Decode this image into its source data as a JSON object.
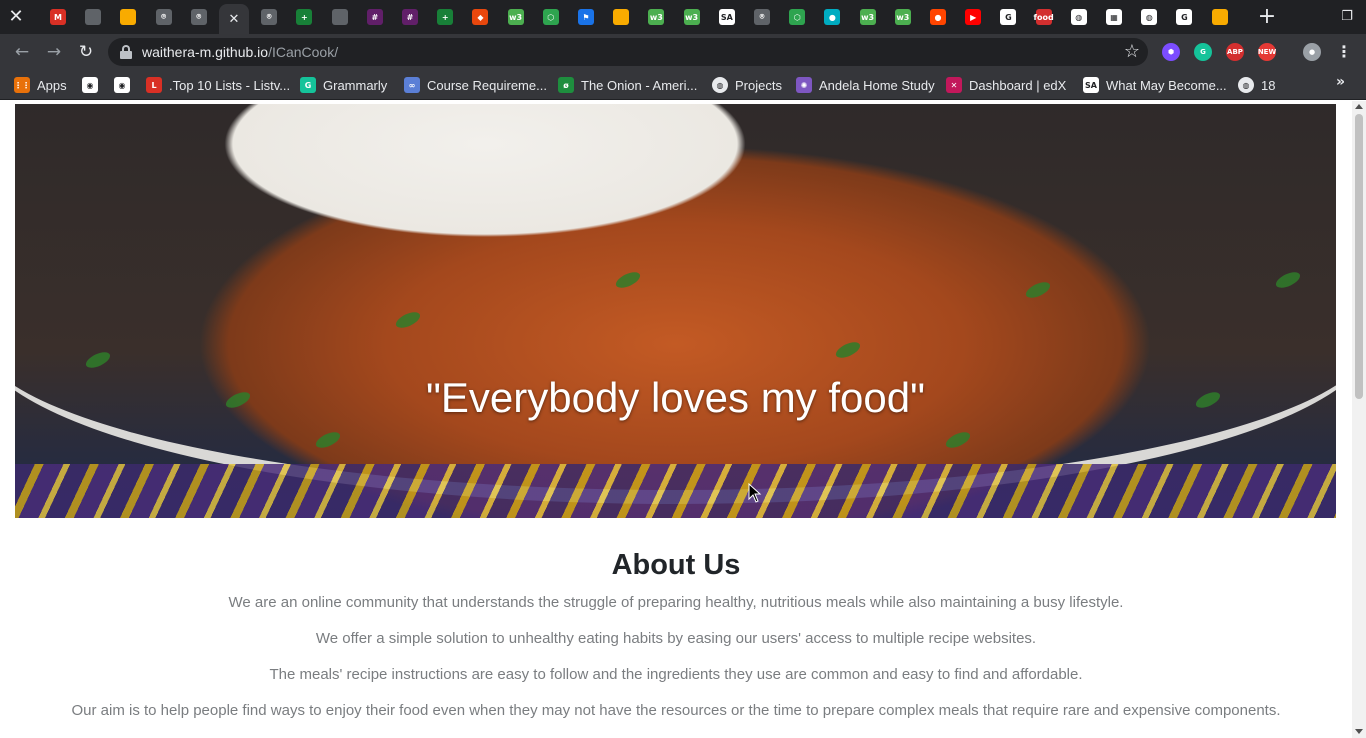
{
  "tabs": [
    {
      "name": "tab-close",
      "icon": "close-icon"
    },
    {
      "name": "tab-gmail",
      "icon": "gmail-icon",
      "color": "#d93025",
      "glyph": "M"
    },
    {
      "name": "tab-generic-1",
      "icon": "page-icon",
      "color": "#5f6368",
      "glyph": ""
    },
    {
      "name": "tab-google-keep",
      "icon": "keep-icon",
      "color": "#f9ab00",
      "glyph": ""
    },
    {
      "name": "tab-github-1",
      "icon": "github-icon",
      "color": "#5f6368",
      "glyph": "⌾"
    },
    {
      "name": "tab-github-2",
      "icon": "github-icon",
      "color": "#5f6368",
      "glyph": "⌾"
    },
    {
      "name": "tab-active",
      "icon": "page-icon",
      "color": "#5f6368",
      "glyph": ""
    },
    {
      "name": "tab-github-3",
      "icon": "github-icon",
      "color": "#5f6368",
      "glyph": "⌾"
    },
    {
      "name": "tab-sheets",
      "icon": "sheets-icon",
      "color": "#188038",
      "glyph": "+"
    },
    {
      "name": "tab-generic-2",
      "icon": "page-icon",
      "color": "#5f6368",
      "glyph": ""
    },
    {
      "name": "tab-slack-1",
      "icon": "slack-icon",
      "color": "#611f69",
      "glyph": "#"
    },
    {
      "name": "tab-slack-2",
      "icon": "slack-icon",
      "color": "#611f69",
      "glyph": "#"
    },
    {
      "name": "tab-sheets-2",
      "icon": "sheets-icon",
      "color": "#188038",
      "glyph": "+"
    },
    {
      "name": "tab-git",
      "icon": "git-icon",
      "color": "#e8470d",
      "glyph": "◆"
    },
    {
      "name": "tab-w3-1",
      "icon": "w3schools-icon",
      "color": "#4caf50",
      "glyph": "w3"
    },
    {
      "name": "tab-codacy",
      "icon": "hexagon-icon",
      "color": "#2ea44f",
      "glyph": "⬡"
    },
    {
      "name": "tab-flag",
      "icon": "flag-icon",
      "color": "#1a73e8",
      "glyph": "⚑"
    },
    {
      "name": "tab-keep-2",
      "icon": "keep-icon",
      "color": "#f9ab00",
      "glyph": ""
    },
    {
      "name": "tab-w3-2",
      "icon": "w3schools-icon",
      "color": "#4caf50",
      "glyph": "w3"
    },
    {
      "name": "tab-w3-3",
      "icon": "w3schools-icon",
      "color": "#4caf50",
      "glyph": "w3"
    },
    {
      "name": "tab-sa",
      "icon": "sa-icon",
      "color": "#ffffff",
      "glyph": "SA"
    },
    {
      "name": "tab-github-4",
      "icon": "github-icon",
      "color": "#5f6368",
      "glyph": "⌾"
    },
    {
      "name": "tab-codacy-2",
      "icon": "hexagon-icon",
      "color": "#2ea44f",
      "glyph": "⬡"
    },
    {
      "name": "tab-person",
      "icon": "person-icon",
      "color": "#00acc1",
      "glyph": "●"
    },
    {
      "name": "tab-w3-4",
      "icon": "w3schools-icon",
      "color": "#4caf50",
      "glyph": "w3"
    },
    {
      "name": "tab-w3-5",
      "icon": "w3schools-icon",
      "color": "#4caf50",
      "glyph": "w3"
    },
    {
      "name": "tab-reddit",
      "icon": "reddit-icon",
      "color": "#ff4500",
      "glyph": "●"
    },
    {
      "name": "tab-youtube",
      "icon": "youtube-icon",
      "color": "#ff0000",
      "glyph": "▶"
    },
    {
      "name": "tab-google-1",
      "icon": "google-icon",
      "color": "#ffffff",
      "glyph": "G"
    },
    {
      "name": "tab-food",
      "icon": "food-icon",
      "color": "#d32f2f",
      "glyph": "food"
    },
    {
      "name": "tab-globe-1",
      "icon": "globe-icon",
      "color": "#ffffff",
      "glyph": "◍"
    },
    {
      "name": "tab-sheets-3",
      "icon": "sheets-icon",
      "color": "#ffffff",
      "glyph": "▦"
    },
    {
      "name": "tab-globe-2",
      "icon": "globe-icon",
      "color": "#ffffff",
      "glyph": "◍"
    },
    {
      "name": "tab-google-2",
      "icon": "google-icon",
      "color": "#ffffff",
      "glyph": "G"
    },
    {
      "name": "tab-keep-3",
      "icon": "keep-icon",
      "color": "#f9ab00",
      "glyph": ""
    }
  ],
  "omnibox": {
    "domain": "waithera-m.github.io",
    "path": "/ICanCook/"
  },
  "extensions": [
    {
      "name": "extension-hexagon",
      "icon": "hexagon-icon",
      "color": "#7c4dff",
      "glyph": "⬢"
    },
    {
      "name": "extension-grammarly",
      "icon": "grammarly-icon",
      "color": "#15c39a",
      "glyph": "G"
    },
    {
      "name": "extension-adblock",
      "icon": "adblock-icon",
      "color": "#d32f2f",
      "glyph": "ABP"
    },
    {
      "name": "extension-new",
      "icon": "new-badge-icon",
      "color": "#e53935",
      "glyph": "NEW"
    },
    {
      "name": "profile-avatar",
      "icon": "avatar-icon",
      "color": "#9aa0a6",
      "glyph": "●"
    }
  ],
  "bookmarks": [
    {
      "label": "Apps",
      "icon": "apps-grid-icon",
      "color": "#e8710a",
      "glyph": "⋮⋮"
    },
    {
      "label": "",
      "icon": "reddit-icon",
      "color": "#ffffff",
      "glyph": "◉"
    },
    {
      "label": "",
      "icon": "reddit-icon",
      "color": "#ffffff",
      "glyph": "◉"
    },
    {
      "label": ".Top 10 Lists - Listv...",
      "icon": "listverse-icon",
      "color": "#d93025",
      "glyph": "L"
    },
    {
      "label": "Grammarly",
      "icon": "grammarly-icon",
      "color": "#15c39a",
      "glyph": "G"
    },
    {
      "label": "Course Requireme...",
      "icon": "infinity-icon",
      "color": "#5b7fd6",
      "glyph": "∞"
    },
    {
      "label": "The Onion - Ameri...",
      "icon": "onion-icon",
      "color": "#1e8e3e",
      "glyph": "ø"
    },
    {
      "label": "Projects",
      "icon": "globe-icon",
      "color": "#e8eaed",
      "glyph": "◍"
    },
    {
      "label": "Andela Home Study",
      "icon": "andela-icon",
      "color": "#7e57c2",
      "glyph": "✺"
    },
    {
      "label": "Dashboard | edX",
      "icon": "edx-icon",
      "color": "#c2185b",
      "glyph": "✕"
    },
    {
      "label": "What May Become...",
      "icon": "sa-icon",
      "color": "#ffffff",
      "glyph": "SA"
    },
    {
      "label": "18",
      "icon": "globe-icon",
      "color": "#e8eaed",
      "glyph": "◍"
    }
  ],
  "hero": {
    "quote": "\"Everybody loves my food\""
  },
  "about": {
    "title": "About Us",
    "paragraphs": [
      "We are an online community that understands the struggle of preparing healthy, nutritious meals while also maintaining a busy lifestyle.",
      "We offer a simple solution to unhealthy eating habits by easing our users' access to multiple recipe websites.",
      "The meals' recipe instructions are easy to follow and the ingredients they use are common and easy to find and affordable.",
      "Our aim is to help people find ways to enjoy their food even when they may not have the resources or the time to prepare complex meals that require rare and expensive components."
    ]
  }
}
